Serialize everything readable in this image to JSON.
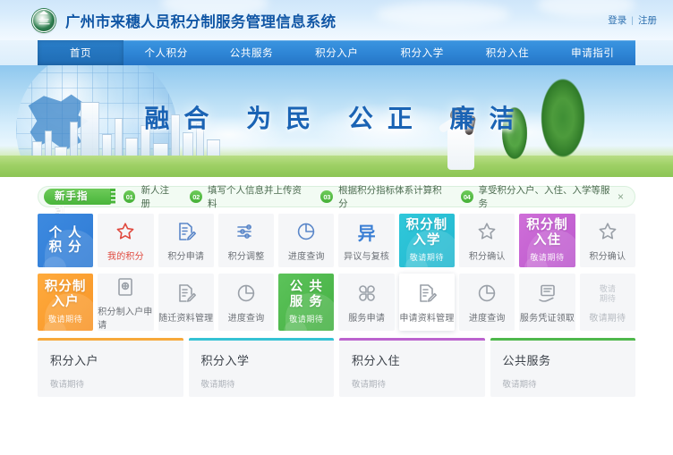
{
  "header": {
    "site_title": "广州市来穗人员积分制服务管理信息系统",
    "logo_name": "guangzhou-emblem-logo",
    "login_label": "登录",
    "separator": "|",
    "register_label": "注册"
  },
  "nav": {
    "items": [
      {
        "label": "首页",
        "active": true
      },
      {
        "label": "个人积分",
        "active": false
      },
      {
        "label": "公共服务",
        "active": false
      },
      {
        "label": "积分入户",
        "active": false
      },
      {
        "label": "积分入学",
        "active": false
      },
      {
        "label": "积分入住",
        "active": false
      },
      {
        "label": "申请指引",
        "active": false
      }
    ]
  },
  "banner": {
    "slogan": "融合 为民 公正 廉洁"
  },
  "guide": {
    "badge_label": "新手指引",
    "steps": [
      {
        "num": "01",
        "text": "新人注册"
      },
      {
        "num": "02",
        "text": "填写个人信息并上传资料"
      },
      {
        "num": "03",
        "text": "根据积分指标体系计算积分"
      },
      {
        "num": "04",
        "text": "享受积分入户、入住、入学等服务"
      }
    ],
    "close_label": "×"
  },
  "tiles": {
    "row1": [
      {
        "kind": "color",
        "color": "blue",
        "title": "个人积分",
        "title_lines": [
          "个 人",
          "积 分"
        ],
        "subtitle": "",
        "icon": "person-silhouette-icon"
      },
      {
        "kind": "icon",
        "label": "我的积分",
        "label_color": "red",
        "icon": "star-icon"
      },
      {
        "kind": "icon",
        "label": "积分申请",
        "label_color": "blue",
        "icon": "document-edit-icon"
      },
      {
        "kind": "icon",
        "label": "积分调整",
        "label_color": "blue",
        "icon": "sliders-icon"
      },
      {
        "kind": "icon",
        "label": "进度查询",
        "label_color": "blue",
        "icon": "pie-progress-icon"
      },
      {
        "kind": "icon",
        "label": "异议与复核",
        "label_color": "blue",
        "icon": "yi-character-icon",
        "glyph_text": "异"
      },
      {
        "kind": "color",
        "color": "cyan",
        "title": "积分制入学",
        "title_lines": [
          "积分制",
          "入学"
        ],
        "subtitle": "敬请期待",
        "icon": "enrollment-tile-icon"
      },
      {
        "kind": "icon",
        "label": "积分确认",
        "label_color": "gray",
        "icon": "star-check-icon"
      },
      {
        "kind": "color",
        "color": "purple",
        "title": "积分制入住",
        "title_lines": [
          "积分制",
          "入住"
        ],
        "subtitle": "敬请期待",
        "icon": "housing-tile-icon"
      },
      {
        "kind": "icon",
        "label": "积分确认",
        "label_color": "gray",
        "icon": "star-check-icon"
      }
    ],
    "row2": [
      {
        "kind": "color",
        "color": "orange",
        "title": "积分制入户",
        "title_lines": [
          "积分制",
          "入户"
        ],
        "subtitle": "敬请期待",
        "icon": "household-tile-icon"
      },
      {
        "kind": "icon",
        "label": "积分制入户申请",
        "label_color": "gray",
        "icon": "certificate-icon"
      },
      {
        "kind": "icon",
        "label": "随迁资料管理",
        "label_color": "gray",
        "icon": "document-edit-icon"
      },
      {
        "kind": "icon",
        "label": "进度查询",
        "label_color": "gray",
        "icon": "pie-progress-icon"
      },
      {
        "kind": "color",
        "color": "green",
        "title": "公共服务",
        "title_lines": [
          "公 共",
          "服 务"
        ],
        "subtitle": "敬请期待",
        "icon": "public-service-tile-icon"
      },
      {
        "kind": "icon",
        "label": "服务申请",
        "label_color": "gray",
        "icon": "grid-apps-icon"
      },
      {
        "kind": "icon",
        "label": "申请资料管理",
        "label_color": "gray",
        "icon": "document-edit-icon",
        "raised": true
      },
      {
        "kind": "icon",
        "label": "进度查询",
        "label_color": "gray",
        "icon": "pie-progress-icon"
      },
      {
        "kind": "icon",
        "label": "服务凭证领取",
        "label_color": "gray",
        "icon": "voucher-hand-icon"
      },
      {
        "kind": "icon",
        "label": "敬请期待",
        "label_color": "dim",
        "icon": "coming-soon-icon",
        "glyph_text": "敬请\n期待"
      }
    ]
  },
  "cards": [
    {
      "title": "积分入户",
      "subtitle": "敬请期待",
      "accent": "#f7a93b",
      "accent_class": "c-orange"
    },
    {
      "title": "积分入学",
      "subtitle": "敬请期待",
      "accent": "#35c2d4",
      "accent_class": "c-cyan"
    },
    {
      "title": "积分入住",
      "subtitle": "敬请期待",
      "accent": "#bb63ce",
      "accent_class": "c-purple"
    },
    {
      "title": "公共服务",
      "subtitle": "敬请期待",
      "accent": "#4fb84c",
      "accent_class": "c-green"
    }
  ],
  "colors": {
    "brand_blue": "#2f7bd4",
    "nav_blue": "#2f86d6",
    "green": "#49b53a",
    "cyan": "#22b7cf",
    "purple": "#bb57cd",
    "orange": "#f79427",
    "red": "#e04a3f"
  }
}
